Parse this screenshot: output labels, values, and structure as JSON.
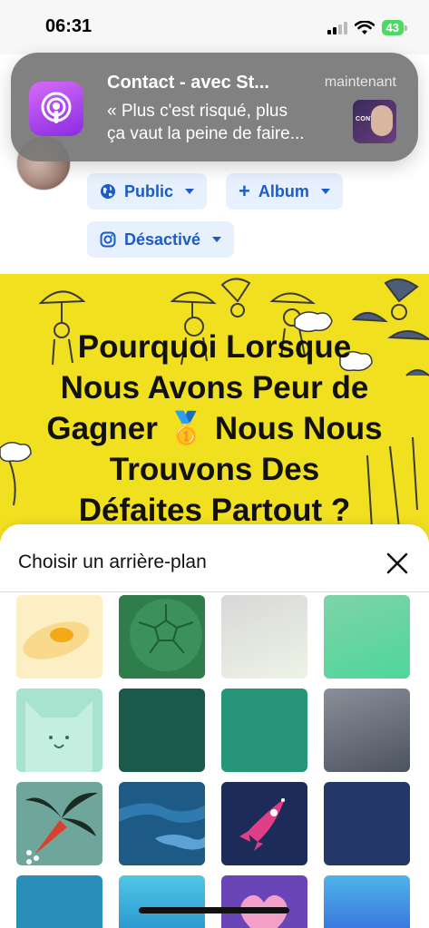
{
  "status_bar": {
    "time": "06:31",
    "battery": "43"
  },
  "notification": {
    "app_icon": "podcast-icon",
    "title": "Contact - avec St...",
    "time": "maintenant",
    "body_line1": "« Plus c'est risqué, plus",
    "body_line2": "ça vaut la peine de faire...",
    "thumb_label": "CONTACT"
  },
  "composer": {
    "audience_label": "Public",
    "album_label": "Album",
    "instagram_label": "Désactivé"
  },
  "post": {
    "line1": "Pourquoi Lorsque",
    "line2": "Nous Avons Peur de",
    "line3": "Gagner 🥇 Nous Nous",
    "line4": "Trouvons Des",
    "line5": "Défaites Partout ?",
    "background": "#f1e020"
  },
  "sheet": {
    "title": "Choisir un arrière-plan",
    "tiles": [
      "egg",
      "football",
      "gray-gradient",
      "mint-gradient",
      "cat",
      "dark-green",
      "teal",
      "slate-gradient",
      "tropical-leaf",
      "ocean-waves",
      "rocket",
      "navy",
      "blue-teal",
      "cyan-wave",
      "purple-heart",
      "blue-gradient"
    ]
  }
}
